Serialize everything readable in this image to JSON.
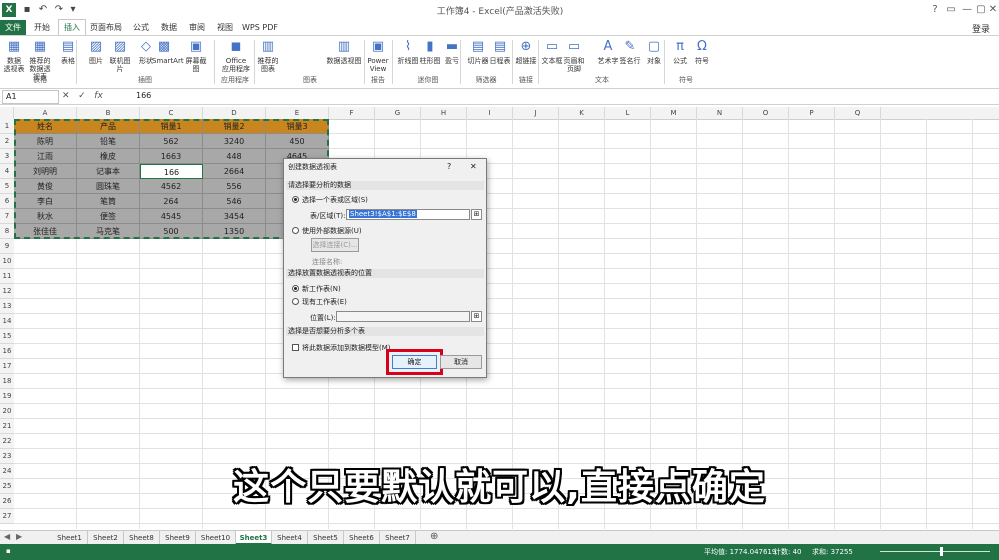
{
  "window": {
    "title": "工作簿4 - Excel(产品激活失败)",
    "login": "登录",
    "controls": [
      "?",
      "▭",
      "—",
      "▢",
      "✕"
    ]
  },
  "tabs": [
    {
      "label": "文件",
      "kind": "file"
    },
    {
      "label": "开始"
    },
    {
      "label": "插入",
      "active": true
    },
    {
      "label": "页面布局"
    },
    {
      "label": "公式"
    },
    {
      "label": "数据"
    },
    {
      "label": "审阅"
    },
    {
      "label": "视图"
    },
    {
      "label": "WPS PDF"
    }
  ],
  "ribbon": {
    "buttons": [
      {
        "label": "数据\n透视表",
        "icon": "pivot-table-icon",
        "glyph": "▦"
      },
      {
        "label": "推荐的\n数据透视表",
        "icon": "recommended-pivot-icon",
        "glyph": "▦"
      },
      {
        "label": "表格",
        "icon": "table-icon",
        "glyph": "▤"
      },
      {
        "label": "图片",
        "icon": "picture-icon",
        "glyph": "▨"
      },
      {
        "label": "联机图片",
        "icon": "online-picture-icon",
        "glyph": "▨"
      },
      {
        "label": "形状",
        "icon": "shapes-icon",
        "glyph": "◇"
      },
      {
        "label": "SmartArt",
        "icon": "smartart-icon",
        "glyph": "▩"
      },
      {
        "label": "屏幕截图",
        "icon": "screenshot-icon",
        "glyph": "▣"
      },
      {
        "label": "Office\n应用程序",
        "icon": "office-apps-icon",
        "glyph": "◼"
      },
      {
        "label": "推荐的\n图表",
        "icon": "recommended-charts-icon",
        "glyph": "▥"
      },
      {
        "label": "数据透视图",
        "icon": "pivot-chart-icon",
        "glyph": "▥"
      },
      {
        "label": "Power\nView",
        "icon": "power-view-icon",
        "glyph": "▣"
      },
      {
        "label": "折线图",
        "icon": "sparkline-line-icon",
        "glyph": "⌇"
      },
      {
        "label": "柱形图",
        "icon": "sparkline-column-icon",
        "glyph": "▮"
      },
      {
        "label": "盈亏",
        "icon": "win-loss-icon",
        "glyph": "▬"
      },
      {
        "label": "切片器",
        "icon": "slicer-icon",
        "glyph": "▤"
      },
      {
        "label": "日程表",
        "icon": "timeline-icon",
        "glyph": "▤"
      },
      {
        "label": "超链接",
        "icon": "hyperlink-icon",
        "glyph": "⊕"
      },
      {
        "label": "文本框",
        "icon": "textbox-icon",
        "glyph": "▭"
      },
      {
        "label": "页眉和页脚",
        "icon": "header-footer-icon",
        "glyph": "▭"
      },
      {
        "label": "艺术字",
        "icon": "wordart-icon",
        "glyph": "A"
      },
      {
        "label": "签名行",
        "icon": "signature-line-icon",
        "glyph": "✎"
      },
      {
        "label": "对象",
        "icon": "object-icon",
        "glyph": "▢"
      },
      {
        "label": "公式",
        "icon": "equation-icon",
        "glyph": "π"
      },
      {
        "label": "符号",
        "icon": "symbol-icon",
        "glyph": "Ω"
      }
    ],
    "groups": [
      "表格",
      "插图",
      "应用程序",
      "图表",
      "报告",
      "迷你图",
      "筛选器",
      "链接",
      "文本",
      "符号"
    ]
  },
  "formula_bar": {
    "name_box": "A1",
    "fx": "fx",
    "value": "166"
  },
  "columns": [
    "A",
    "B",
    "C",
    "D",
    "E",
    "F",
    "G",
    "H",
    "I",
    "J",
    "K",
    "L",
    "M",
    "N",
    "O",
    "P",
    "Q"
  ],
  "rows": [
    "1",
    "2",
    "3",
    "4",
    "5",
    "6",
    "7",
    "8",
    "9",
    "10",
    "11",
    "12",
    "13",
    "14",
    "15",
    "16",
    "17",
    "18",
    "19",
    "20",
    "21",
    "22",
    "23",
    "24",
    "25",
    "26",
    "27"
  ],
  "table": {
    "header": [
      "姓名",
      "产品",
      "销量1",
      "销量2",
      "销量3"
    ],
    "rows": [
      [
        "陈明",
        "铅笔",
        "562",
        "3240",
        "450"
      ],
      [
        "江雨",
        "橡皮",
        "1663",
        "448",
        "4645"
      ],
      [
        "刘明明",
        "记事本",
        "166",
        "2664",
        ""
      ],
      [
        "黄俊",
        "圆珠笔",
        "4562",
        "556",
        ""
      ],
      [
        "李白",
        "笔筒",
        "264",
        "546",
        ""
      ],
      [
        "秋水",
        "便签",
        "4545",
        "3454",
        ""
      ],
      [
        "张佳佳",
        "马克笔",
        "500",
        "1350",
        ""
      ]
    ],
    "header_color": "#c9861f",
    "body_color": "#a8a8a8"
  },
  "dialog": {
    "title": "创建数据透视表",
    "help": "?",
    "close": "✕",
    "section1": "请选择要分析的数据",
    "opt_range": "选择一个表或区域(S)",
    "range_label": "表/区域(T):",
    "range_value": "Sheet3!$A$1:$E$8",
    "opt_external": "使用外部数据源(U)",
    "choose_conn": "选择连接(C)...",
    "conn_name": "连接名称:",
    "section2": "选择放置数据透视表的位置",
    "opt_new": "新工作表(N)",
    "opt_existing": "现有工作表(E)",
    "location_label": "位置(L):",
    "section3": "选择是否想要分析多个表",
    "add_model": "将此数据添加到数据模型(M)",
    "ok": "确定",
    "cancel": "取消"
  },
  "sheets": [
    "Sheet1",
    "Sheet2",
    "Sheet8",
    "Sheet9",
    "Sheet10",
    "Sheet3",
    "Sheet4",
    "Sheet5",
    "Sheet6",
    "Sheet7"
  ],
  "active_sheet": "Sheet3",
  "status": {
    "average": "平均值: 1774.047619",
    "count": "计数: 40",
    "sum": "求和: 37255"
  },
  "subtitle": "这个只要默认就可以,直接点确定",
  "colors": {
    "excel_green": "#217346",
    "highlight_red": "#d9001b"
  }
}
